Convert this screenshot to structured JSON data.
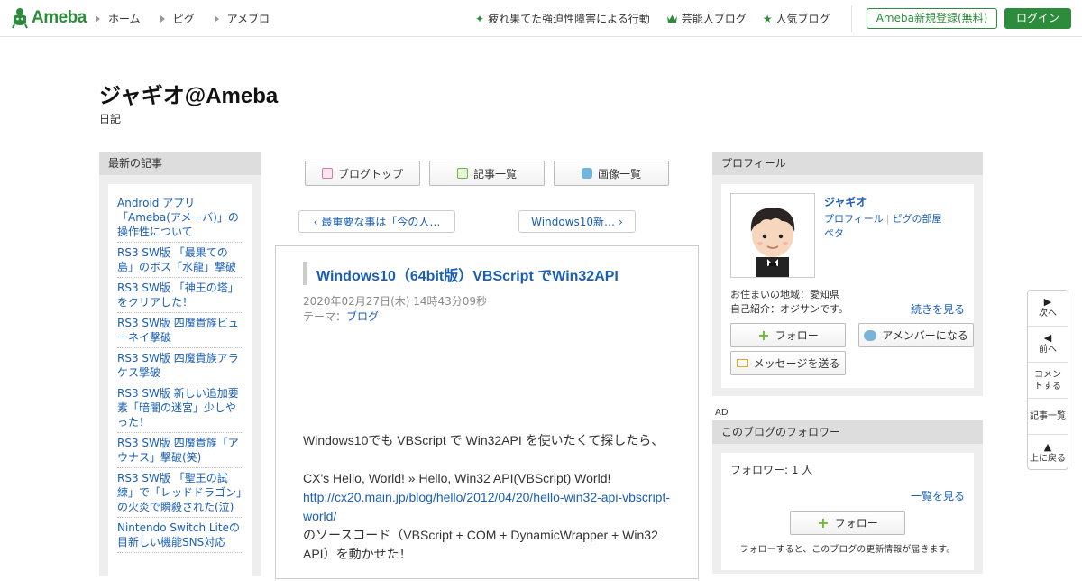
{
  "header": {
    "logo_text": "Ameba",
    "nav_left": [
      "ホーム",
      "ピグ",
      "アメブロ"
    ],
    "nav_right": [
      {
        "label": "疲れ果てた強迫性障害による行動",
        "icon": "sparkle-icon"
      },
      {
        "label": "芸能人ブログ",
        "icon": "crown-icon"
      },
      {
        "label": "人気ブログ",
        "icon": "star-icon"
      }
    ],
    "register_label": "Ameba新規登録(無料)",
    "login_label": "ログイン"
  },
  "blog": {
    "title": "ジャギオ@Ameba",
    "subtitle": "日記"
  },
  "recent": {
    "heading": "最新の記事",
    "items": [
      "Android アプリ「Ameba(アメーバ)」の操作性について",
      "RS3 SW版 「最果ての島」のボス「水龍」撃破",
      "RS3 SW版 「神王の塔」をクリアした！",
      "RS3 SW版 四魔貴族ビューネイ撃破",
      "RS3 SW版 四魔貴族アラケス撃破",
      "RS3 SW版 新しい追加要素「暗闇の迷宮」少しやった！",
      "RS3 SW版 四魔貴族「アウナス」撃破(笑)",
      "RS3 SW版 「聖王の試練」で「レッドドラゴン」の火炎で瞬殺された(泣)",
      "Nintendo Switch Liteの目新しい機能SNS対応"
    ]
  },
  "tabs": {
    "blog_top": "ブログトップ",
    "entry_list": "記事一覧",
    "image_list": "画像一覧"
  },
  "pager": {
    "prev": "最重要な事は「今の人…",
    "next": "Windows10新…"
  },
  "entry": {
    "title": "Windows10（64bit版）VBScript でWin32API",
    "date": "2020年02月27日(木) 14時43分09秒",
    "theme_label": "テーマ：",
    "theme": "ブログ",
    "body_1": "Windows10でも VBScript で Win32API を使いたくて探したら、",
    "body_2": "CX's Hello, World! » Hello, Win32 API(VBScript) World!",
    "body_link": "http://cx20.main.jp/blog/hello/2012/04/20/hello-win32-api-vbscript-world/",
    "body_3": "のソースコード（VBScript + COM + DynamicWrapper + Win32 API）を動かせた！"
  },
  "profile": {
    "heading": "プロフィール",
    "name": "ジャギオ",
    "link_profile": "プロフィール",
    "link_pig_room": "ピグの部屋",
    "link_peta": "ペタ",
    "location": "お住まいの地域：愛知県",
    "intro": "自己紹介：オジサンです。",
    "more": "続きを見る",
    "follow": "フォロー",
    "amember": "アメンバーになる",
    "message": "メッセージを送る"
  },
  "ad_label": "AD",
  "followers": {
    "heading": "このブログのフォロワー",
    "count_text": "フォロワー: 1 人",
    "see_all": "一覧を見る",
    "follow": "フォロー",
    "note": "フォローすると、このブログの更新情報が届きます。"
  },
  "sidenav": {
    "next": "次へ",
    "prev": "前へ",
    "comment": "コメントする",
    "list": "記事一覧",
    "top": "上に戻る"
  },
  "colors": {
    "brand_green": "#2d8c3c",
    "link_blue": "#1a5fb4"
  }
}
